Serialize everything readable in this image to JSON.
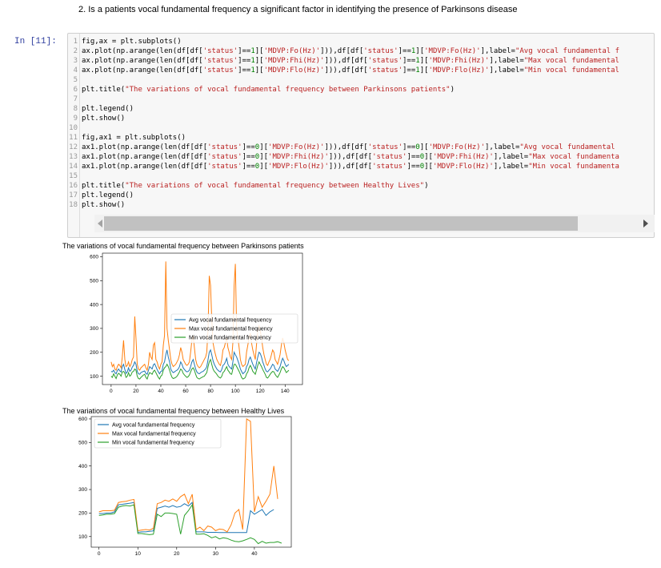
{
  "question": "2. Is a patients vocal fundamental frequency a significant factor in identifying the presence of Parkinsons disease",
  "prompt": "In [11]:",
  "code_lines": [
    [
      [
        "t",
        "fig,ax = plt.subplots()"
      ]
    ],
    [
      [
        "t",
        "ax.plot(np.arange(len(df[df["
      ],
      [
        "s",
        "'status'"
      ],
      [
        "t",
        "]=="
      ],
      [
        "n",
        "1"
      ],
      [
        "t",
        "]["
      ],
      [
        "s",
        "'MDVP:Fo(Hz)'"
      ],
      [
        "t",
        "])),df[df["
      ],
      [
        "s",
        "'status'"
      ],
      [
        "t",
        "]=="
      ],
      [
        "n",
        "1"
      ],
      [
        "t",
        "]["
      ],
      [
        "s",
        "'MDVP:Fo(Hz)'"
      ],
      [
        "t",
        "],label="
      ],
      [
        "s",
        "\"Avg vocal fundamental f"
      ]
    ],
    [
      [
        "t",
        "ax.plot(np.arange(len(df[df["
      ],
      [
        "s",
        "'status'"
      ],
      [
        "t",
        "]=="
      ],
      [
        "n",
        "1"
      ],
      [
        "t",
        "]["
      ],
      [
        "s",
        "'MDVP:Fhi(Hz)'"
      ],
      [
        "t",
        "])),df[df["
      ],
      [
        "s",
        "'status'"
      ],
      [
        "t",
        "]=="
      ],
      [
        "n",
        "1"
      ],
      [
        "t",
        "]["
      ],
      [
        "s",
        "'MDVP:Fhi(Hz)'"
      ],
      [
        "t",
        "],label="
      ],
      [
        "s",
        "\"Max vocal fundamental"
      ]
    ],
    [
      [
        "t",
        "ax.plot(np.arange(len(df[df["
      ],
      [
        "s",
        "'status'"
      ],
      [
        "t",
        "]=="
      ],
      [
        "n",
        "1"
      ],
      [
        "t",
        "]["
      ],
      [
        "s",
        "'MDVP:Flo(Hz)'"
      ],
      [
        "t",
        "])),df[df["
      ],
      [
        "s",
        "'status'"
      ],
      [
        "t",
        "]=="
      ],
      [
        "n",
        "1"
      ],
      [
        "t",
        "]["
      ],
      [
        "s",
        "'MDVP:Flo(Hz)'"
      ],
      [
        "t",
        "],label="
      ],
      [
        "s",
        "\"Min vocal fundamental"
      ]
    ],
    [],
    [
      [
        "t",
        "plt.title("
      ],
      [
        "s",
        "\"The variations of vocal fundamental frequency between Parkinsons patients\""
      ],
      [
        "t",
        ")"
      ]
    ],
    [],
    [
      [
        "t",
        "plt.legend()"
      ]
    ],
    [
      [
        "t",
        "plt.show()"
      ]
    ],
    [],
    [
      [
        "t",
        "fig,ax1 = plt.subplots()"
      ]
    ],
    [
      [
        "t",
        "ax1.plot(np.arange(len(df[df["
      ],
      [
        "s",
        "'status'"
      ],
      [
        "t",
        "]=="
      ],
      [
        "n",
        "0"
      ],
      [
        "t",
        "]["
      ],
      [
        "s",
        "'MDVP:Fo(Hz)'"
      ],
      [
        "t",
        "])),df[df["
      ],
      [
        "s",
        "'status'"
      ],
      [
        "t",
        "]=="
      ],
      [
        "n",
        "0"
      ],
      [
        "t",
        "]["
      ],
      [
        "s",
        "'MDVP:Fo(Hz)'"
      ],
      [
        "t",
        "],label="
      ],
      [
        "s",
        "\"Avg vocal fundamental"
      ]
    ],
    [
      [
        "t",
        "ax1.plot(np.arange(len(df[df["
      ],
      [
        "s",
        "'status'"
      ],
      [
        "t",
        "]=="
      ],
      [
        "n",
        "0"
      ],
      [
        "t",
        "]["
      ],
      [
        "s",
        "'MDVP:Fhi(Hz)'"
      ],
      [
        "t",
        "])),df[df["
      ],
      [
        "s",
        "'status'"
      ],
      [
        "t",
        "]=="
      ],
      [
        "n",
        "0"
      ],
      [
        "t",
        "]["
      ],
      [
        "s",
        "'MDVP:Fhi(Hz)'"
      ],
      [
        "t",
        "],label="
      ],
      [
        "s",
        "\"Max vocal fundamenta"
      ]
    ],
    [
      [
        "t",
        "ax1.plot(np.arange(len(df[df["
      ],
      [
        "s",
        "'status'"
      ],
      [
        "t",
        "]=="
      ],
      [
        "n",
        "0"
      ],
      [
        "t",
        "]["
      ],
      [
        "s",
        "'MDVP:Flo(Hz)'"
      ],
      [
        "t",
        "])),df[df["
      ],
      [
        "s",
        "'status'"
      ],
      [
        "t",
        "]=="
      ],
      [
        "n",
        "0"
      ],
      [
        "t",
        "]["
      ],
      [
        "s",
        "'MDVP:Flo(Hz)'"
      ],
      [
        "t",
        "],label="
      ],
      [
        "s",
        "\"Min vocal fundamenta"
      ]
    ],
    [],
    [
      [
        "t",
        "plt.title("
      ],
      [
        "s",
        "\"The variations of vocal fundamental frequency between Healthy Lives\""
      ],
      [
        "t",
        ")"
      ]
    ],
    [
      [
        "t",
        "plt.legend()"
      ]
    ],
    [
      [
        "t",
        "plt.show()"
      ]
    ]
  ],
  "colors": {
    "avg": "#1f77b4",
    "max": "#ff7f0e",
    "min": "#2ca02c"
  },
  "chart_data": [
    {
      "type": "line",
      "title": "The variations of vocal fundamental frequency between Parkinsons patients",
      "xlim": [
        -7,
        154
      ],
      "ylim": [
        65,
        615
      ],
      "xticks": [
        0,
        20,
        40,
        60,
        80,
        100,
        120,
        140
      ],
      "yticks": [
        100,
        200,
        300,
        400,
        500,
        600
      ],
      "legend": "center-right",
      "series": [
        {
          "name": "Avg vocal fundamental frequency",
          "key": "avg",
          "values": [
            120,
            118,
            125,
            115,
            110,
            123,
            130,
            122,
            118,
            140,
            150,
            128,
            112,
            118,
            135,
            120,
            125,
            138,
            145,
            160,
            150,
            120,
            110,
            108,
            115,
            118,
            120,
            122,
            112,
            108,
            124,
            140,
            135,
            130,
            148,
            152,
            140,
            128,
            118,
            110,
            120,
            122,
            150,
            160,
            190,
            210,
            180,
            160,
            130,
            120,
            115,
            118,
            122,
            125,
            130,
            140,
            160,
            150,
            135,
            128,
            122,
            118,
            120,
            125,
            140,
            160,
            170,
            150,
            130,
            118,
            112,
            110,
            115,
            118,
            120,
            125,
            130,
            140,
            170,
            200,
            210,
            190,
            165,
            150,
            140,
            130,
            125,
            120,
            118,
            128,
            145,
            150,
            160,
            175,
            150,
            140,
            135,
            130,
            160,
            200,
            190,
            180,
            165,
            150,
            130,
            120,
            110,
            115,
            120,
            140,
            150,
            170,
            180,
            165,
            150,
            140,
            130,
            155,
            180,
            200,
            195,
            180,
            160,
            145,
            130,
            120,
            118,
            125,
            130,
            140,
            150,
            145,
            130,
            125,
            120,
            130,
            140,
            160,
            175,
            165,
            150,
            140,
            145,
            150
          ]
        },
        {
          "name": "Max vocal fundamental frequency",
          "key": "max",
          "values": [
            160,
            140,
            150,
            130,
            125,
            140,
            150,
            145,
            135,
            180,
            250,
            170,
            140,
            145,
            160,
            140,
            150,
            170,
            180,
            350,
            260,
            150,
            130,
            125,
            135,
            140,
            145,
            150,
            135,
            125,
            150,
            200,
            180,
            170,
            230,
            240,
            170,
            160,
            140,
            130,
            150,
            160,
            230,
            270,
            580,
            300,
            250,
            210,
            170,
            150,
            140,
            145,
            150,
            160,
            170,
            190,
            220,
            200,
            170,
            160,
            150,
            145,
            150,
            160,
            200,
            250,
            270,
            220,
            170,
            150,
            140,
            135,
            140,
            150,
            160,
            170,
            180,
            200,
            300,
            520,
            480,
            340,
            240,
            210,
            190,
            170,
            160,
            150,
            145,
            170,
            210,
            220,
            240,
            260,
            220,
            200,
            180,
            170,
            240,
            480,
            570,
            300,
            260,
            220,
            170,
            150,
            140,
            145,
            150,
            200,
            230,
            260,
            280,
            240,
            210,
            190,
            170,
            230,
            290,
            310,
            290,
            260,
            220,
            190,
            170,
            150,
            145,
            160,
            170,
            190,
            210,
            200,
            170,
            160,
            150,
            170,
            190,
            230,
            260,
            240,
            210,
            190,
            170,
            165
          ]
        },
        {
          "name": "Min vocal fundamental frequency",
          "key": "min",
          "values": [
            100,
            95,
            110,
            100,
            90,
            105,
            112,
            108,
            100,
            118,
            120,
            112,
            95,
            100,
            115,
            100,
            105,
            118,
            120,
            130,
            125,
            100,
            90,
            88,
            95,
            100,
            105,
            108,
            95,
            88,
            105,
            115,
            112,
            108,
            120,
            125,
            115,
            105,
            95,
            88,
            100,
            105,
            125,
            135,
            140,
            150,
            140,
            125,
            108,
            95,
            90,
            92,
            95,
            100,
            108,
            118,
            130,
            125,
            112,
            105,
            100,
            95,
            98,
            105,
            118,
            130,
            135,
            125,
            108,
            95,
            90,
            88,
            92,
            95,
            98,
            100,
            108,
            115,
            140,
            160,
            170,
            150,
            130,
            120,
            115,
            108,
            100,
            95,
            92,
            100,
            115,
            120,
            130,
            140,
            125,
            118,
            110,
            108,
            130,
            150,
            150,
            140,
            130,
            120,
            108,
            95,
            88,
            90,
            95,
            110,
            118,
            135,
            145,
            135,
            120,
            115,
            108,
            125,
            145,
            160,
            150,
            140,
            128,
            118,
            108,
            95,
            92,
            100,
            108,
            115,
            120,
            118,
            108,
            100,
            95,
            105,
            115,
            130,
            140,
            135,
            125,
            115,
            120,
            125
          ]
        }
      ]
    },
    {
      "type": "line",
      "title": "The variations of vocal fundamental frequency between Healthy Lives",
      "xlim": [
        -2,
        49.5
      ],
      "ylim": [
        55,
        610
      ],
      "xticks": [
        0,
        10,
        20,
        30,
        40
      ],
      "yticks": [
        100,
        200,
        300,
        400,
        500,
        600
      ],
      "legend": "top-left",
      "series": [
        {
          "name": "Avg vocal fundamental frequency",
          "key": "avg",
          "values": [
            198,
            198,
            200,
            200,
            205,
            235,
            237,
            240,
            242,
            245,
            118,
            120,
            120,
            122,
            124,
            220,
            225,
            230,
            225,
            232,
            225,
            228,
            240,
            230,
            245,
            120,
            120,
            120,
            118,
            118,
            118,
            117,
            117,
            117,
            117,
            117,
            117,
            117,
            117,
            210,
            195,
            205,
            215,
            190,
            205,
            215
          ]
        },
        {
          "name": "Max vocal fundamental frequency",
          "key": "max",
          "values": [
            205,
            210,
            210,
            210,
            212,
            245,
            248,
            250,
            255,
            258,
            125,
            128,
            130,
            128,
            135,
            240,
            245,
            255,
            250,
            260,
            250,
            270,
            280,
            240,
            280,
            130,
            140,
            125,
            145,
            140,
            125,
            132,
            130,
            120,
            150,
            200,
            215,
            130,
            600,
            590,
            205,
            270,
            225,
            250,
            280,
            400,
            260
          ]
        },
        {
          "name": "Min vocal fundamental frequency",
          "key": "min",
          "values": [
            190,
            192,
            195,
            195,
            198,
            225,
            230,
            232,
            230,
            235,
            113,
            113,
            110,
            108,
            110,
            195,
            185,
            200,
            200,
            198,
            195,
            110,
            190,
            210,
            235,
            110,
            110,
            112,
            105,
            95,
            100,
            90,
            95,
            92,
            85,
            80,
            78,
            82,
            88,
            95,
            88,
            70,
            80,
            72,
            75,
            75,
            78,
            72
          ]
        }
      ]
    }
  ]
}
